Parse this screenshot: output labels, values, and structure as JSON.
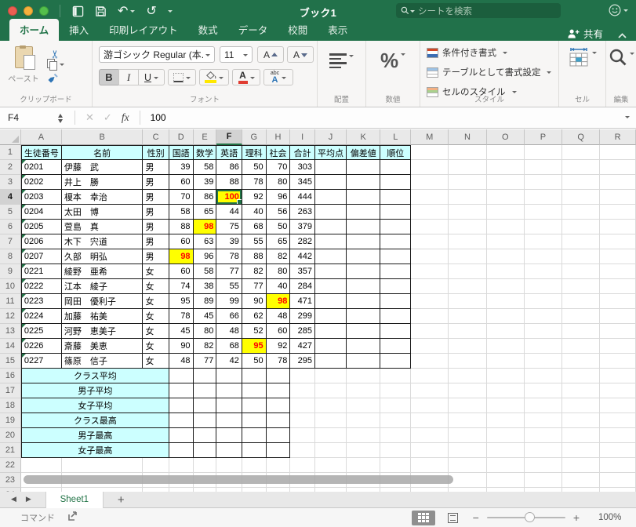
{
  "titlebar": {
    "title": "ブック1",
    "search_placeholder": "シートを検索"
  },
  "tabs": [
    {
      "label": "ホーム",
      "active": true
    },
    {
      "label": "挿入",
      "active": false
    },
    {
      "label": "印刷レイアウト",
      "active": false
    },
    {
      "label": "数式",
      "active": false
    },
    {
      "label": "データ",
      "active": false
    },
    {
      "label": "校閲",
      "active": false
    },
    {
      "label": "表示",
      "active": false
    }
  ],
  "share_label": "共有",
  "ribbon": {
    "clipboard": {
      "paste_label": "ペースト",
      "group_label": "クリップボード"
    },
    "font": {
      "font_name": "游ゴシック Regular (本...",
      "font_size": "11",
      "bold": "B",
      "italic": "I",
      "underline": "U",
      "phonetic_top": "abc",
      "phonetic_bottom": "A",
      "color_letter": "A",
      "size_letter_up": "A",
      "size_letter_down": "A",
      "group_label": "フォント"
    },
    "alignment": {
      "group_label": "配置"
    },
    "number": {
      "percent": "%",
      "group_label": "数値"
    },
    "styles": {
      "conditional": "条件付き書式",
      "format_table": "テーブルとして書式設定",
      "cell_styles": "セルのスタイル",
      "group_label": "スタイル"
    },
    "cells": {
      "group_label": "セル"
    },
    "editing": {
      "group_label": "編集"
    }
  },
  "formula_bar": {
    "cell_reference": "F4",
    "fx": "fx",
    "value": "100"
  },
  "grid": {
    "col_headers": [
      "A",
      "B",
      "C",
      "D",
      "E",
      "F",
      "G",
      "H",
      "I",
      "J",
      "K",
      "L",
      "M",
      "N",
      "O",
      "P",
      "Q",
      "R"
    ],
    "selected_col": "F",
    "selected_row": 4,
    "visible_rows": 24,
    "score_cols": [
      "D",
      "E",
      "F",
      "G",
      "H"
    ],
    "table_headers": [
      "生徒番号",
      "名前",
      "性別",
      "国語",
      "数学",
      "英語",
      "理科",
      "社会",
      "合計",
      "平均点",
      "偏差値",
      "順位"
    ],
    "students": [
      {
        "id": "0201",
        "name": "伊藤　武",
        "gender": "男",
        "scores": [
          39,
          58,
          86,
          50,
          70
        ],
        "total": 303
      },
      {
        "id": "0202",
        "name": "井上　勝",
        "gender": "男",
        "scores": [
          60,
          39,
          88,
          78,
          80
        ],
        "total": 345
      },
      {
        "id": "0203",
        "name": "榎本　幸治",
        "gender": "男",
        "scores": [
          70,
          86,
          100,
          92,
          96
        ],
        "total": 444,
        "highlight_col": "F"
      },
      {
        "id": "0204",
        "name": "太田　博",
        "gender": "男",
        "scores": [
          58,
          65,
          44,
          40,
          56
        ],
        "total": 263
      },
      {
        "id": "0205",
        "name": "萱島　真",
        "gender": "男",
        "scores": [
          88,
          98,
          75,
          68,
          50
        ],
        "total": 379,
        "highlight_col": "E"
      },
      {
        "id": "0206",
        "name": "木下　宍道",
        "gender": "男",
        "scores": [
          60,
          63,
          39,
          55,
          65
        ],
        "total": 282
      },
      {
        "id": "0207",
        "name": "久部　明弘",
        "gender": "男",
        "scores": [
          98,
          96,
          78,
          88,
          82
        ],
        "total": 442,
        "highlight_col": "D"
      },
      {
        "id": "0221",
        "name": "綾野　亜希",
        "gender": "女",
        "scores": [
          60,
          58,
          77,
          82,
          80
        ],
        "total": 357
      },
      {
        "id": "0222",
        "name": "江本　綾子",
        "gender": "女",
        "scores": [
          74,
          38,
          55,
          77,
          40
        ],
        "total": 284
      },
      {
        "id": "0223",
        "name": "岡田　優利子",
        "gender": "女",
        "scores": [
          95,
          89,
          99,
          90,
          98
        ],
        "total": 471,
        "highlight_col": "H"
      },
      {
        "id": "0224",
        "name": "加藤　祐美",
        "gender": "女",
        "scores": [
          78,
          45,
          66,
          62,
          48
        ],
        "total": 299
      },
      {
        "id": "0225",
        "name": "河野　恵美子",
        "gender": "女",
        "scores": [
          45,
          80,
          48,
          52,
          60
        ],
        "total": 285
      },
      {
        "id": "0226",
        "name": "斎藤　美恵",
        "gender": "女",
        "scores": [
          90,
          82,
          68,
          95,
          92
        ],
        "total": 427,
        "highlight_col": "G"
      },
      {
        "id": "0227",
        "name": "篠原　信子",
        "gender": "女",
        "scores": [
          48,
          77,
          42,
          50,
          78
        ],
        "total": 295
      }
    ],
    "summary_rows": [
      "クラス平均",
      "男子平均",
      "女子平均",
      "クラス最高",
      "男子最高",
      "女子最高"
    ]
  },
  "sheet_bar": {
    "sheet_name": "Sheet1",
    "add": "+"
  },
  "status_bar": {
    "mode": "コマンド",
    "zoom_level": "100%"
  },
  "colors": {
    "excel_green": "#217346",
    "highlight_fill": "#FFFF00",
    "highlight_text": "#FF0000",
    "table_header_fill": "#CCFFFF"
  }
}
